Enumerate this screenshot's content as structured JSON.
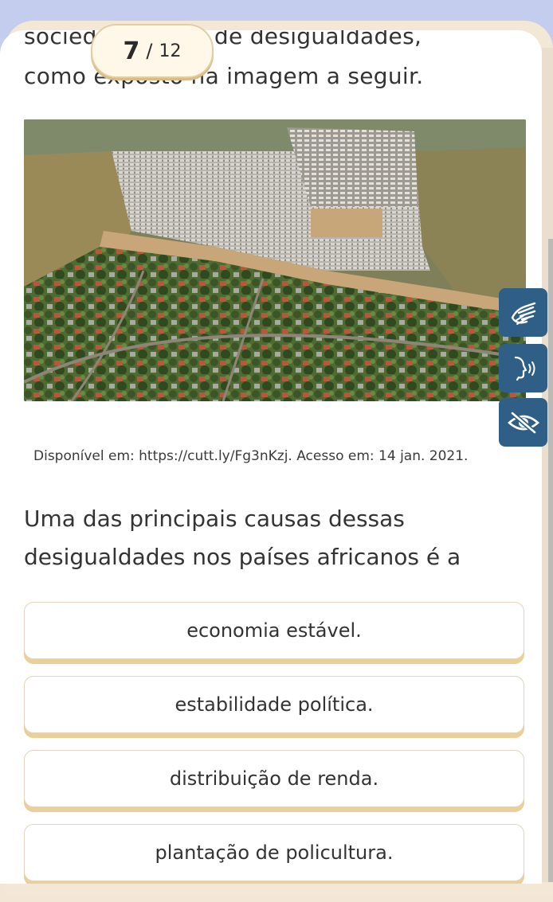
{
  "intro": {
    "line1": "socied          alto grau de desigualdades,",
    "line2": "como exposto na imagem a seguir."
  },
  "counter": {
    "current": "7",
    "separator": "/",
    "total": "12"
  },
  "image": {
    "alt": "Vista aérea de assentamento informal ao lado de bairro residencial"
  },
  "caption": "Disponível em: https://cutt.ly/Fg3nKzj. Acesso em: 14 jan. 2021.",
  "question": "Uma das principais causas dessas desigualdades nos países africanos é a",
  "options": [
    {
      "label": "economia estável."
    },
    {
      "label": "estabilidade política."
    },
    {
      "label": "distribuição de renda."
    },
    {
      "label": "plantação de policultura."
    }
  ],
  "accessibility": [
    {
      "icon": "sign-language-icon"
    },
    {
      "icon": "speech-audio-icon"
    },
    {
      "icon": "eye-off-icon"
    }
  ],
  "colors": {
    "accent": "#2f5f86",
    "option_shadow": "#ead098",
    "background": "#c5cdee"
  }
}
